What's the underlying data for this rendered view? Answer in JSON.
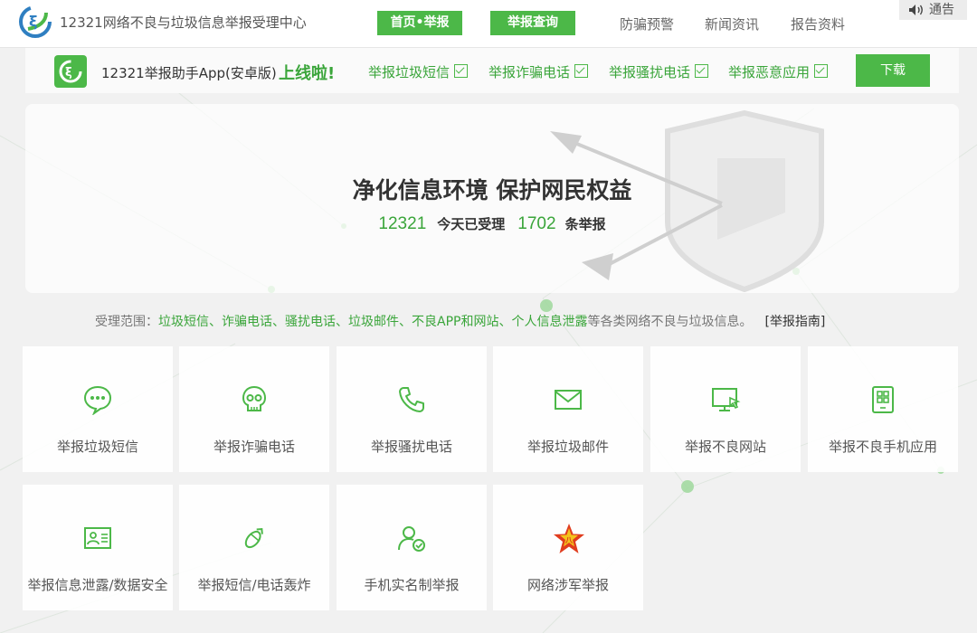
{
  "header": {
    "site_title": "12321网络不良与垃圾信息举报受理中心",
    "nav": [
      {
        "label": "首页•举报",
        "active": true
      },
      {
        "label": "举报查询",
        "active": true
      },
      {
        "label": "防骗预警",
        "active": false
      },
      {
        "label": "新闻资讯",
        "active": false
      },
      {
        "label": "报告资料",
        "active": false
      }
    ],
    "notice_label": "通告"
  },
  "app_banner": {
    "name": "12321举报助手App(安卓版)",
    "online_text": "上线啦!",
    "features": [
      "举报垃圾短信",
      "举报诈骗电话",
      "举报骚扰电话",
      "举报恶意应用"
    ],
    "download_label": "下载"
  },
  "hero": {
    "title": "净化信息环境 保护网民权益",
    "org": "12321",
    "today_label": "今天已受理",
    "count": "1702",
    "count_unit": "条举报"
  },
  "scope": {
    "label": "受理范围：",
    "items": "垃圾短信、诈骗电话、骚扰电话、垃圾邮件、不良APP和网站、个人信息泄露",
    "tail": "等各类网络不良与垃圾信息。",
    "guide_label": "[举报指南]"
  },
  "cards": [
    {
      "label": "举报垃圾短信",
      "icon": "sms-bubble-icon"
    },
    {
      "label": "举报诈骗电话",
      "icon": "skull-icon"
    },
    {
      "label": "举报骚扰电话",
      "icon": "phone-icon"
    },
    {
      "label": "举报垃圾邮件",
      "icon": "envelope-icon"
    },
    {
      "label": "举报不良网站",
      "icon": "monitor-cursor-icon"
    },
    {
      "label": "举报不良手机应用",
      "icon": "mobile-app-grid-icon"
    },
    {
      "label": "举报信息泄露/数据安全",
      "icon": "id-card-icon"
    },
    {
      "label": "举报短信/电话轰炸",
      "icon": "bomb-icon"
    },
    {
      "label": "手机实名制举报",
      "icon": "user-check-icon"
    },
    {
      "label": "网络涉军举报",
      "icon": "army-star-icon"
    }
  ],
  "colors": {
    "brand_green": "#4cb848",
    "text_green": "#3aa53a",
    "star_red": "#e03c1e",
    "star_yellow": "#f3c31c"
  }
}
